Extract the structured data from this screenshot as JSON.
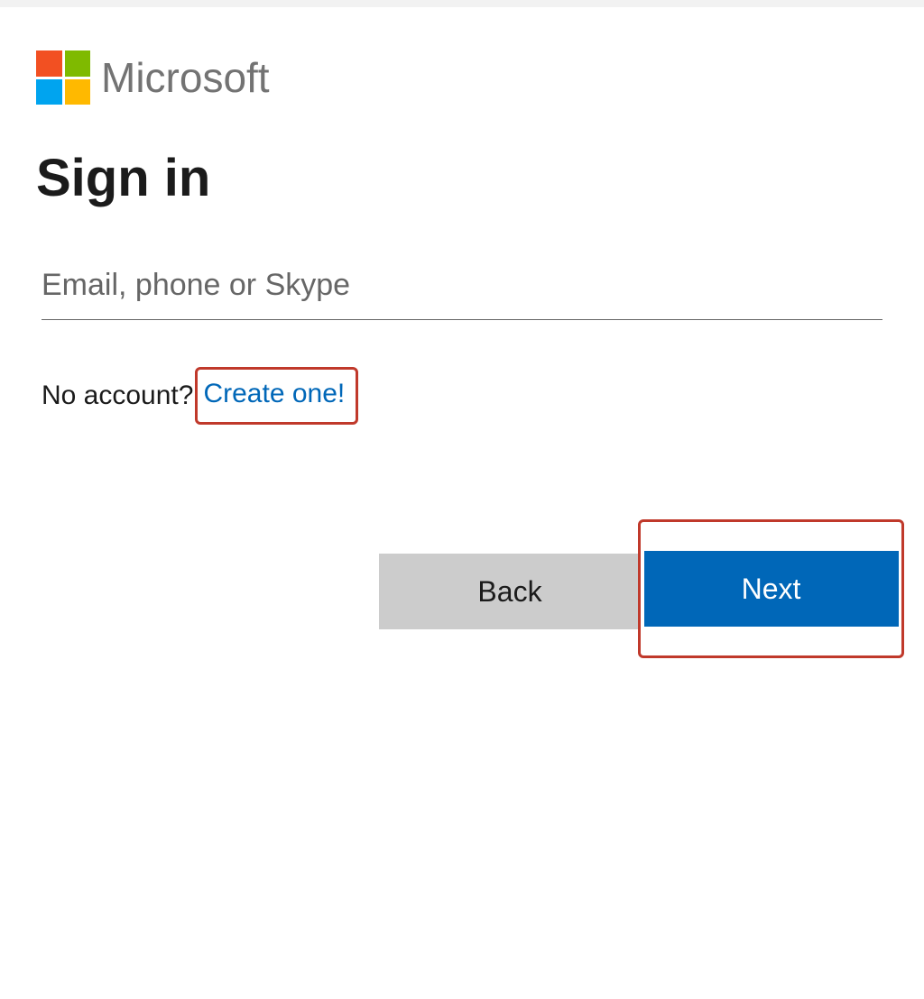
{
  "brand": {
    "name": "Microsoft",
    "logo_colors": {
      "top_left": "#f25022",
      "top_right": "#7fba00",
      "bottom_left": "#00a4ef",
      "bottom_right": "#ffb900"
    }
  },
  "page": {
    "title": "Sign in"
  },
  "form": {
    "email_placeholder": "Email, phone or Skype",
    "email_value": ""
  },
  "signup": {
    "prompt": "No account?",
    "link_text": "Create one!"
  },
  "buttons": {
    "back": "Back",
    "next": "Next"
  },
  "highlight": {
    "color": "#c0392b",
    "targets": [
      "create-account-link",
      "next-button"
    ]
  },
  "colors": {
    "primary": "#0067b8",
    "secondary_button": "#cccccc",
    "text": "#1b1b1b",
    "muted": "#737373"
  }
}
